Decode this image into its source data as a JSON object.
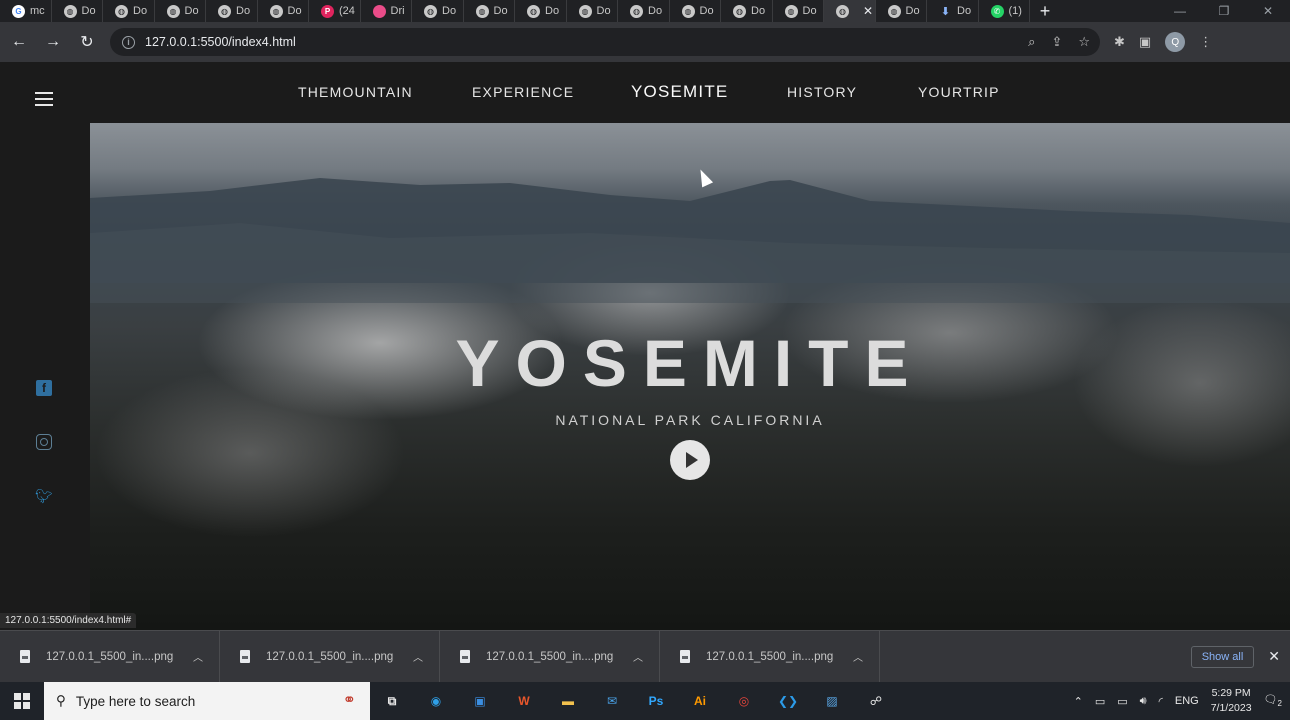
{
  "browser": {
    "tabs": [
      {
        "label": "mc",
        "icon": "google-icon"
      },
      {
        "label": "Do",
        "icon": "globe-icon"
      },
      {
        "label": "Do",
        "icon": "globe-icon"
      },
      {
        "label": "Do",
        "icon": "globe-icon"
      },
      {
        "label": "Do",
        "icon": "globe-icon"
      },
      {
        "label": "Do",
        "icon": "globe-icon"
      },
      {
        "label": "(24",
        "icon": "pinterest-icon"
      },
      {
        "label": "Dri",
        "icon": "dribbble-icon"
      },
      {
        "label": "Do",
        "icon": "globe-icon"
      },
      {
        "label": "Do",
        "icon": "globe-icon"
      },
      {
        "label": "Do",
        "icon": "globe-icon"
      },
      {
        "label": "Do",
        "icon": "globe-icon"
      },
      {
        "label": "Do",
        "icon": "globe-icon"
      },
      {
        "label": "Do",
        "icon": "globe-icon"
      },
      {
        "label": "Do",
        "icon": "globe-icon"
      },
      {
        "label": "Do",
        "icon": "globe-icon"
      },
      {
        "label": "",
        "icon": "globe-icon",
        "active": true
      },
      {
        "label": "Do",
        "icon": "globe-icon"
      },
      {
        "label": "Do",
        "icon": "download-icon"
      },
      {
        "label": "(1)",
        "icon": "whatsapp-icon"
      }
    ],
    "url": "127.0.0.1:5500/index4.html",
    "avatar_initial": "Q",
    "status_url": "127.0.0.1:5500/index4.html#"
  },
  "site": {
    "nav": [
      {
        "label": "THEMOUNTAIN",
        "active": false
      },
      {
        "label": "EXPERIENCE",
        "active": false
      },
      {
        "label": "YOSEMITE",
        "active": true
      },
      {
        "label": "HISTORY",
        "active": false
      },
      {
        "label": "YOURTRIP",
        "active": false
      }
    ],
    "hero": {
      "title": "YOSEMITE",
      "subtitle": "NATIONAL PARK CALIFORNIA"
    },
    "social": [
      "facebook-icon",
      "instagram-icon",
      "twitter-icon"
    ]
  },
  "downloads": {
    "items": [
      {
        "name": "127.0.0.1_5500_in....png"
      },
      {
        "name": "127.0.0.1_5500_in....png"
      },
      {
        "name": "127.0.0.1_5500_in....png"
      },
      {
        "name": "127.0.0.1_5500_in....png"
      }
    ],
    "show_all": "Show all"
  },
  "taskbar": {
    "search_placeholder": "Type here to search",
    "apps": [
      {
        "name": "task-view-icon",
        "glyph": "⧉",
        "color": "#e8e8e8"
      },
      {
        "name": "edge-icon",
        "glyph": "◉",
        "color": "#2fa0e8"
      },
      {
        "name": "store-icon",
        "glyph": "▣",
        "color": "#3b8ee0"
      },
      {
        "name": "office-icon",
        "glyph": "W",
        "color": "#e8562b"
      },
      {
        "name": "file-explorer-icon",
        "glyph": "▬",
        "color": "#f2c14e"
      },
      {
        "name": "mail-icon",
        "glyph": "✉",
        "color": "#4aa3e8"
      },
      {
        "name": "photoshop-icon",
        "glyph": "Ps",
        "color": "#31a8ff"
      },
      {
        "name": "illustrator-icon",
        "glyph": "Ai",
        "color": "#ff9a00"
      },
      {
        "name": "chrome-icon",
        "glyph": "◎",
        "color": "#e8453c"
      },
      {
        "name": "vscode-icon",
        "glyph": "❮❯",
        "color": "#2c9be8"
      },
      {
        "name": "photos-icon",
        "glyph": "▨",
        "color": "#5aa8e8"
      },
      {
        "name": "people-icon",
        "glyph": "☍",
        "color": "#e8e8e8"
      }
    ],
    "language": "ENG",
    "time": "5:29 PM",
    "date": "7/1/2023",
    "notification_count": "2"
  },
  "colors": {
    "page_bg": "#1b1b1b",
    "hero_text": "#dcdcdc",
    "facebook": "#2f6f9f",
    "twitter": "#2f8ec8"
  }
}
